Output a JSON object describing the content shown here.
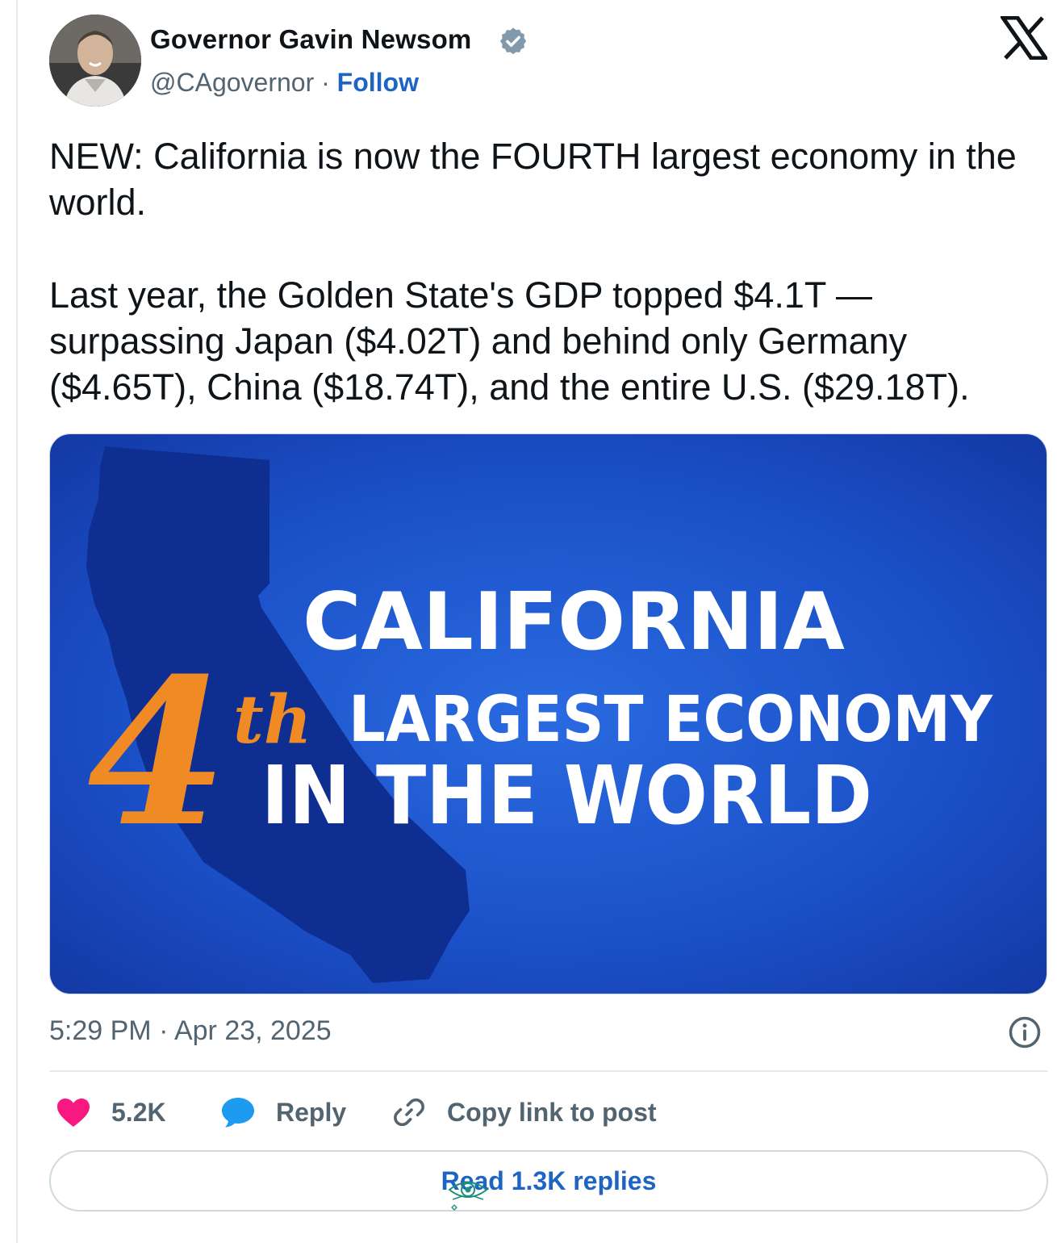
{
  "author": {
    "name": "Governor Gavin Newsom",
    "handle": "@CAgovernor",
    "separator": " · ",
    "follow_label": "Follow"
  },
  "icons": {
    "verified": "verified-badge-icon",
    "logo": "x-logo-icon",
    "info": "info-icon",
    "like": "heart-icon",
    "reply": "reply-bubble-icon",
    "copy": "link-icon"
  },
  "tweet": {
    "paragraph1": "NEW: California is now the FOURTH largest economy in the world.",
    "paragraph2": "Last year, the Golden State's GDP topped $4.1T — surpassing Japan ($4.02T) and behind only Germany ($4.65T), China ($18.74T), and the entire U.S. ($29.18T)."
  },
  "media": {
    "headline": "CALIFORNIA",
    "rank_number": "4",
    "rank_suffix": "th",
    "line2": "LARGEST ECONOMY",
    "line3": "IN THE WORLD"
  },
  "meta": {
    "timestamp": "5:29 PM · Apr 23, 2025"
  },
  "actions": {
    "likes": "5.2K",
    "reply_label": "Reply",
    "copy_label": "Copy link to post"
  },
  "replies_button": "Read 1.3K replies",
  "colors": {
    "link_blue": "#1d64c3",
    "like_pink": "#f91880",
    "reply_blue": "#1d9bf0",
    "gray_text": "#536471",
    "media_blue": "#1a4fc4",
    "state_blue": "#0e2e91",
    "accent_orange": "#f08a24"
  }
}
